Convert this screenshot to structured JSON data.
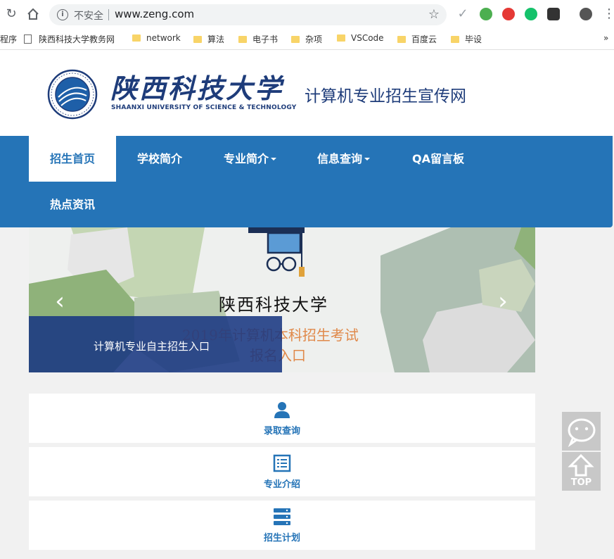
{
  "browser": {
    "insecure_label": "不安全",
    "url": "www.zeng.com",
    "bookmarks": [
      {
        "label": "程序",
        "kind": "text"
      },
      {
        "label": "陕西科技大学教务网",
        "kind": "page"
      },
      {
        "label": "network",
        "kind": "folder"
      },
      {
        "label": "算法",
        "kind": "folder"
      },
      {
        "label": "电子书",
        "kind": "folder"
      },
      {
        "label": "杂项",
        "kind": "folder"
      },
      {
        "label": "VSCode",
        "kind": "folder"
      },
      {
        "label": "百度云",
        "kind": "folder"
      },
      {
        "label": "毕设",
        "kind": "folder"
      }
    ],
    "overflow": "»"
  },
  "header": {
    "logo_cn": "陕西科技大学",
    "logo_en": "SHAANXI UNIVERSITY OF SCIENCE & TECHNOLOGY",
    "site_title": "计算机专业招生宣传网"
  },
  "nav": {
    "items": [
      {
        "label": "招生首页",
        "active": true
      },
      {
        "label": "学校简介"
      },
      {
        "label": "专业简介",
        "dropdown": true
      },
      {
        "label": "信息查询",
        "dropdown": true
      },
      {
        "label": "QA留言板"
      },
      {
        "label": "热点资讯"
      }
    ]
  },
  "carousel": {
    "banner_title": "陕西科技大学",
    "banner_line1": "2019年计算机本科招生考试",
    "banner_line2": "报名入口",
    "caption": "计算机专业自主招生入口",
    "prev": "‹",
    "next": "›"
  },
  "cards": [
    {
      "label": "录取查询",
      "icon": "user-icon"
    },
    {
      "label": "专业介绍",
      "icon": "list-icon"
    },
    {
      "label": "招生计划",
      "icon": "server-icon"
    }
  ],
  "float": {
    "top_label": "TOP"
  },
  "colors": {
    "primary": "#2574b7",
    "brand_dark": "#1e3c7a",
    "caption_bg": "#193782",
    "banner_accent": "#e0894a"
  }
}
